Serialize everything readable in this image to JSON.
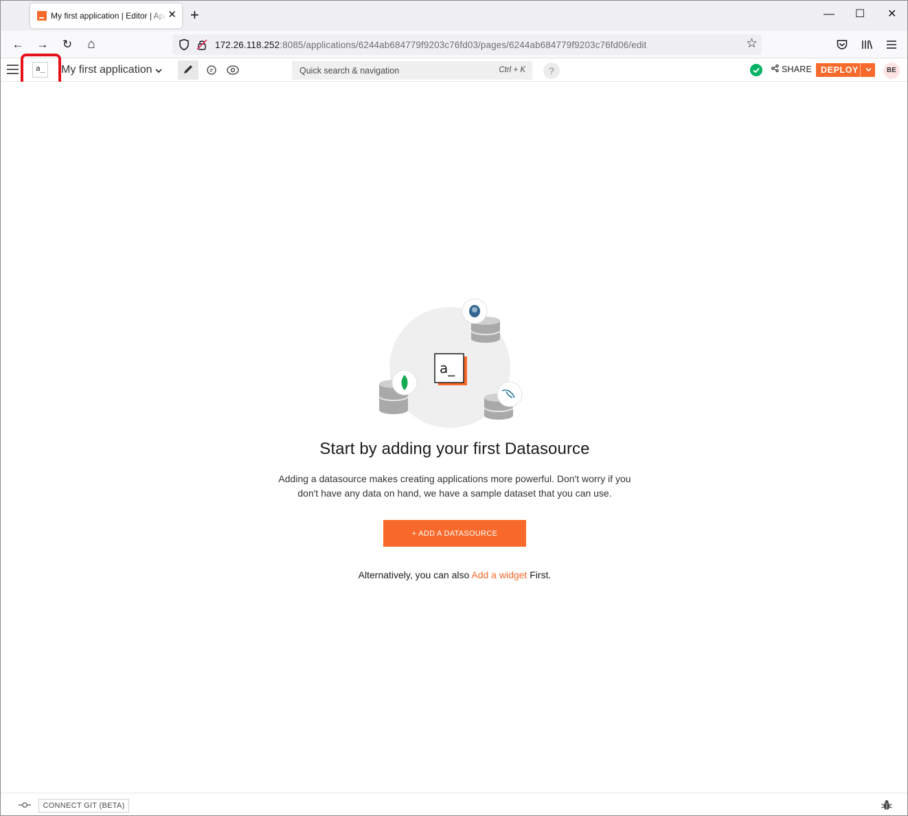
{
  "browser": {
    "tab_title": "My first application | Editor | Appsmith",
    "tab_close": "✕",
    "new_tab": "+",
    "window_controls": {
      "minimize": "—",
      "maximize": "☐",
      "close": "✕"
    },
    "nav": {
      "back": "←",
      "forward": "→",
      "reload": "↻",
      "home": "⌂",
      "star": "☆"
    },
    "url_host": "172.26.118.252",
    "url_rest": ":8085/applications/6244ab684779f9203c76fd03/pages/6244ab684779f9203c76fd06/edit",
    "toolbar_icons": [
      "pocket-icon",
      "library-icon",
      "menu-icon"
    ]
  },
  "header": {
    "app_name": "My first application",
    "app_chevron": "⌄",
    "logo_text": "a_",
    "search_placeholder": "Quick search & navigation",
    "search_shortcut": "Ctrl + K",
    "help": "?",
    "share_label": "SHARE",
    "deploy_label": "DEPLOY",
    "avatar_initials": "BE",
    "colors": {
      "accent": "#f86a2b",
      "saved": "#03b365",
      "highlight": "#e5121b"
    }
  },
  "canvas": {
    "illustration_logo_text": "a_",
    "heading": "Start by adding your first Datasource",
    "description": "Adding a datasource makes creating applications more powerful. Don't worry if you don't have any data on hand, we have a sample dataset that you can use.",
    "add_datasource_label": "+ ADD A DATASOURCE",
    "alt_prefix": "Alternatively, you can also ",
    "alt_link": "Add a widget",
    "alt_suffix": " First."
  },
  "footer": {
    "connect_git_label": "CONNECT GIT (BETA)"
  }
}
